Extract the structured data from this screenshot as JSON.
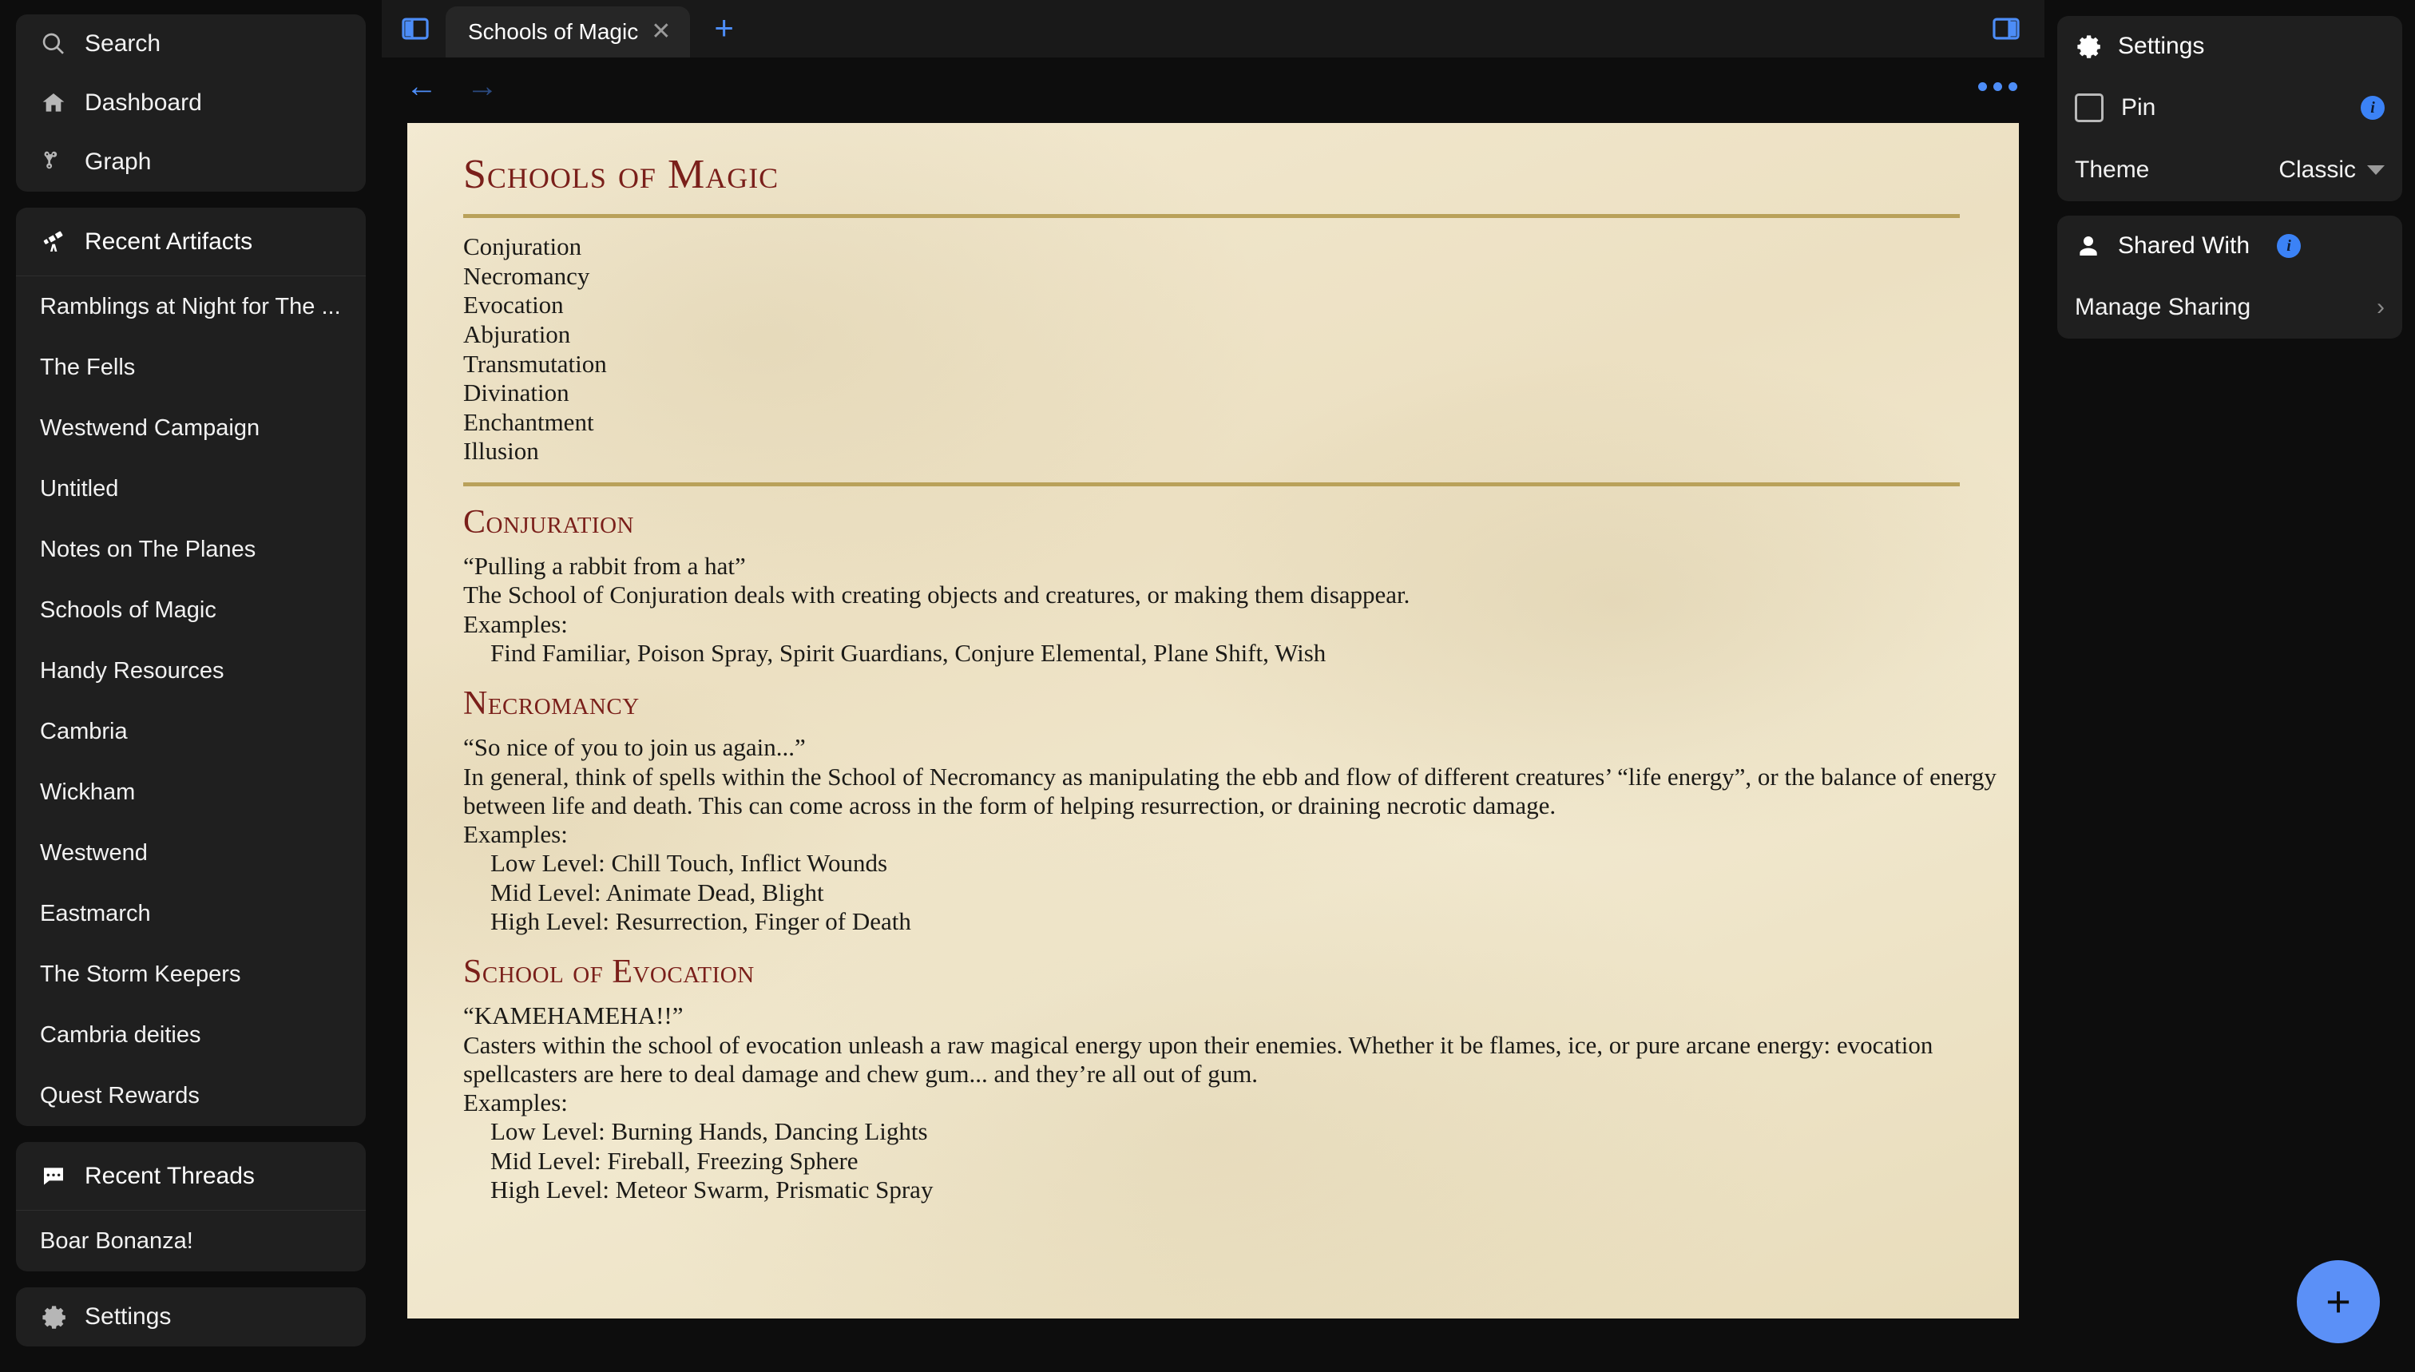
{
  "sidebar": {
    "nav": [
      {
        "label": "Search",
        "icon": "search-icon"
      },
      {
        "label": "Dashboard",
        "icon": "home-icon"
      },
      {
        "label": "Graph",
        "icon": "graph-icon"
      }
    ],
    "artifacts": {
      "header": "Recent Artifacts",
      "header_icon": "telescope-icon",
      "items": [
        "Ramblings at Night for The ...",
        "The Fells",
        "Westwend Campaign",
        "Untitled",
        "Notes on The Planes",
        "Schools of Magic",
        "Handy Resources",
        "Cambria",
        "Wickham",
        "Westwend",
        "Eastmarch",
        "The Storm Keepers",
        "Cambria deities",
        "Quest Rewards"
      ]
    },
    "threads": {
      "header": "Recent Threads",
      "header_icon": "chat-bubble-icon",
      "items": [
        "Boar Bonanza!"
      ]
    },
    "settings": {
      "label": "Settings",
      "icon": "gear-icon"
    }
  },
  "tabbar": {
    "left_panel_toggle": "panel-left-icon",
    "right_panel_toggle": "panel-right-icon",
    "tabs": [
      {
        "label": "Schools of Magic",
        "close": "✕",
        "active": true
      }
    ],
    "add_tab": "+"
  },
  "toolbar": {
    "back": "←",
    "forward": "→",
    "more": "more-options-icon"
  },
  "document": {
    "title": "Schools of Magic",
    "schools": [
      "Conjuration",
      "Necromancy",
      "Evocation",
      "Abjuration",
      "Transmutation",
      "Divination",
      "Enchantment",
      "Illusion"
    ],
    "sections": [
      {
        "heading": "Conjuration",
        "lines": [
          {
            "text": "“Pulling a rabbit from a hat”",
            "indent": false
          },
          {
            "text": "The School of Conjuration deals with creating objects and creatures, or making them disappear.",
            "indent": false
          },
          {
            "text": "Examples:",
            "indent": false
          },
          {
            "text": "Find Familiar, Poison Spray, Spirit Guardians, Conjure Elemental, Plane Shift, Wish",
            "indent": true
          }
        ]
      },
      {
        "heading": "Necromancy",
        "lines": [
          {
            "text": "“So nice of you to join us again...”",
            "indent": false
          },
          {
            "text": "In general, think of spells within the School of Necromancy as manipulating the ebb and flow of different creatures’ “life energy”, or the balance of energy",
            "indent": false
          },
          {
            "text": "between life and death. This can come across in the form of helping resurrection, or draining necrotic damage.",
            "indent": false
          },
          {
            "text": "Examples:",
            "indent": false
          },
          {
            "text": "Low Level: Chill Touch, Inflict Wounds",
            "indent": true
          },
          {
            "text": "Mid Level: Animate Dead, Blight",
            "indent": true
          },
          {
            "text": "High Level: Resurrection, Finger of Death",
            "indent": true
          }
        ]
      },
      {
        "heading": "School of Evocation",
        "lines": [
          {
            "text": "“KAMEHAMEHA!!”",
            "indent": false
          },
          {
            "text": "Casters within the school of evocation unleash a raw magical energy upon their enemies. Whether it be flames, ice, or pure arcane energy: evocation",
            "indent": false
          },
          {
            "text": "spellcasters are here to deal damage and chew gum... and they’re all out of gum.",
            "indent": false
          },
          {
            "text": "Examples:",
            "indent": false
          },
          {
            "text": "Low Level: Burning Hands, Dancing Lights",
            "indent": true
          },
          {
            "text": "Mid Level: Fireball, Freezing Sphere",
            "indent": true
          },
          {
            "text": "High Level: Meteor Swarm, Prismatic Spray",
            "indent": true
          }
        ]
      }
    ]
  },
  "right_panel": {
    "settings": {
      "header": "Settings",
      "header_icon": "gear-icon",
      "pin_label": "Pin",
      "pin_checked": false,
      "pin_info": "i",
      "theme_label": "Theme",
      "theme_value": "Classic"
    },
    "shared": {
      "header": "Shared With",
      "header_icon": "person-icon",
      "info": "i",
      "manage_label": "Manage Sharing",
      "chevron": "›"
    }
  },
  "fab": {
    "label": "+"
  },
  "colors": {
    "accent_blue": "#4d8df7",
    "fab_blue": "#5b90f7",
    "paper": "#ece0c2",
    "heading_red": "#7a1f1a",
    "rule_gold": "#b9a15a",
    "app_bg": "#0d0d0d",
    "card_bg": "#1f1f1f"
  }
}
